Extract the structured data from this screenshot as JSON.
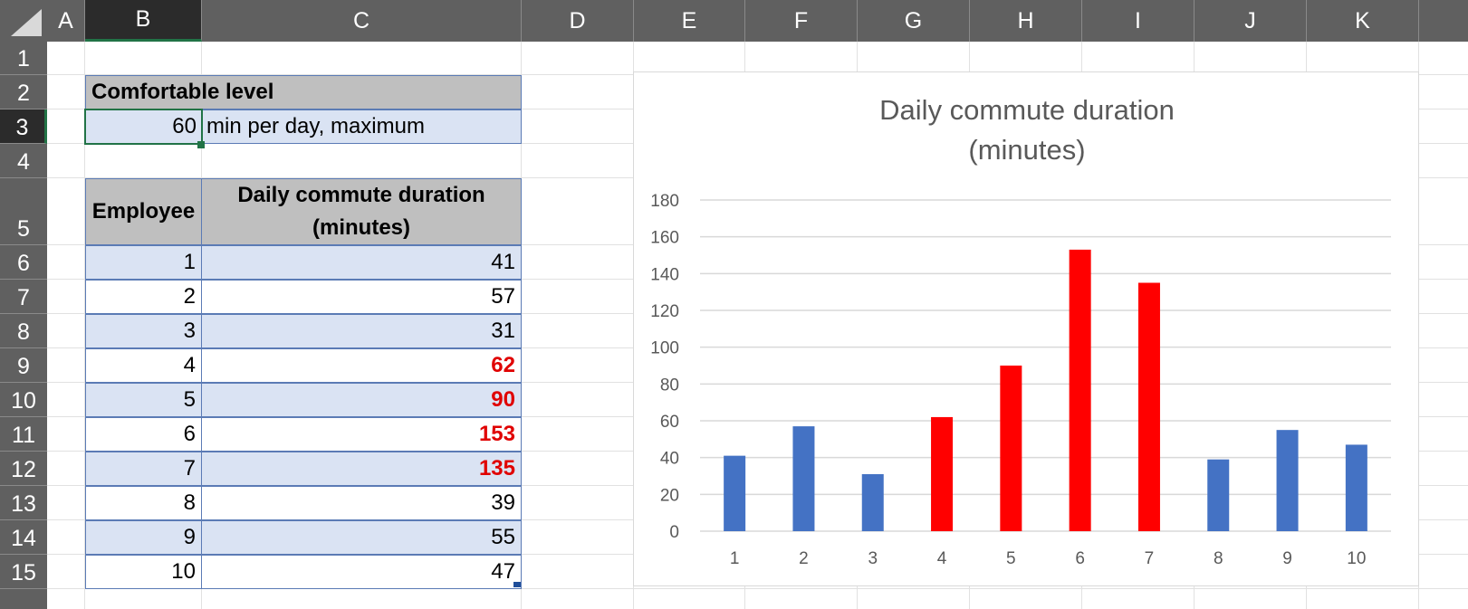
{
  "columns": [
    "A",
    "B",
    "C",
    "D",
    "E",
    "F",
    "G",
    "H",
    "I",
    "J",
    "K"
  ],
  "rows": [
    "1",
    "2",
    "3",
    "4",
    "5",
    "6",
    "7",
    "8",
    "9",
    "10",
    "11",
    "12",
    "13",
    "14",
    "15"
  ],
  "selected_column": "B",
  "selected_row": "3",
  "sheet": {
    "comfortable_label": "Comfortable level",
    "comfortable_value": "60",
    "comfortable_unit": "min per day, maximum",
    "table_header_employee": "Employee",
    "table_header_duration_line1": "Daily commute duration",
    "table_header_duration_line2": "(minutes)",
    "employees": [
      {
        "id": "1",
        "minutes": "41"
      },
      {
        "id": "2",
        "minutes": "57"
      },
      {
        "id": "3",
        "minutes": "31"
      },
      {
        "id": "4",
        "minutes": "62"
      },
      {
        "id": "5",
        "minutes": "90"
      },
      {
        "id": "6",
        "minutes": "153"
      },
      {
        "id": "7",
        "minutes": "135"
      },
      {
        "id": "8",
        "minutes": "39"
      },
      {
        "id": "9",
        "minutes": "55"
      },
      {
        "id": "10",
        "minutes": "47"
      }
    ]
  },
  "colors": {
    "normal_bar": "#4472c4",
    "over_limit_bar": "#ff0000",
    "over_limit_text": "#e00000",
    "table_band": "#dae3f3",
    "table_header_fill": "#bfbfbf",
    "header_bar": "#606060",
    "selection_green": "#217346"
  },
  "chart_data": {
    "type": "bar",
    "title_line1": "Daily commute duration",
    "title_line2": "(minutes)",
    "categories": [
      "1",
      "2",
      "3",
      "4",
      "5",
      "6",
      "7",
      "8",
      "9",
      "10"
    ],
    "values": [
      41,
      57,
      31,
      62,
      90,
      153,
      135,
      39,
      55,
      47
    ],
    "threshold": 60,
    "ylim": [
      0,
      180
    ],
    "yticks": [
      0,
      20,
      40,
      60,
      80,
      100,
      120,
      140,
      160,
      180
    ],
    "grid": true,
    "legend": "none",
    "xlabel": "",
    "ylabel": ""
  }
}
